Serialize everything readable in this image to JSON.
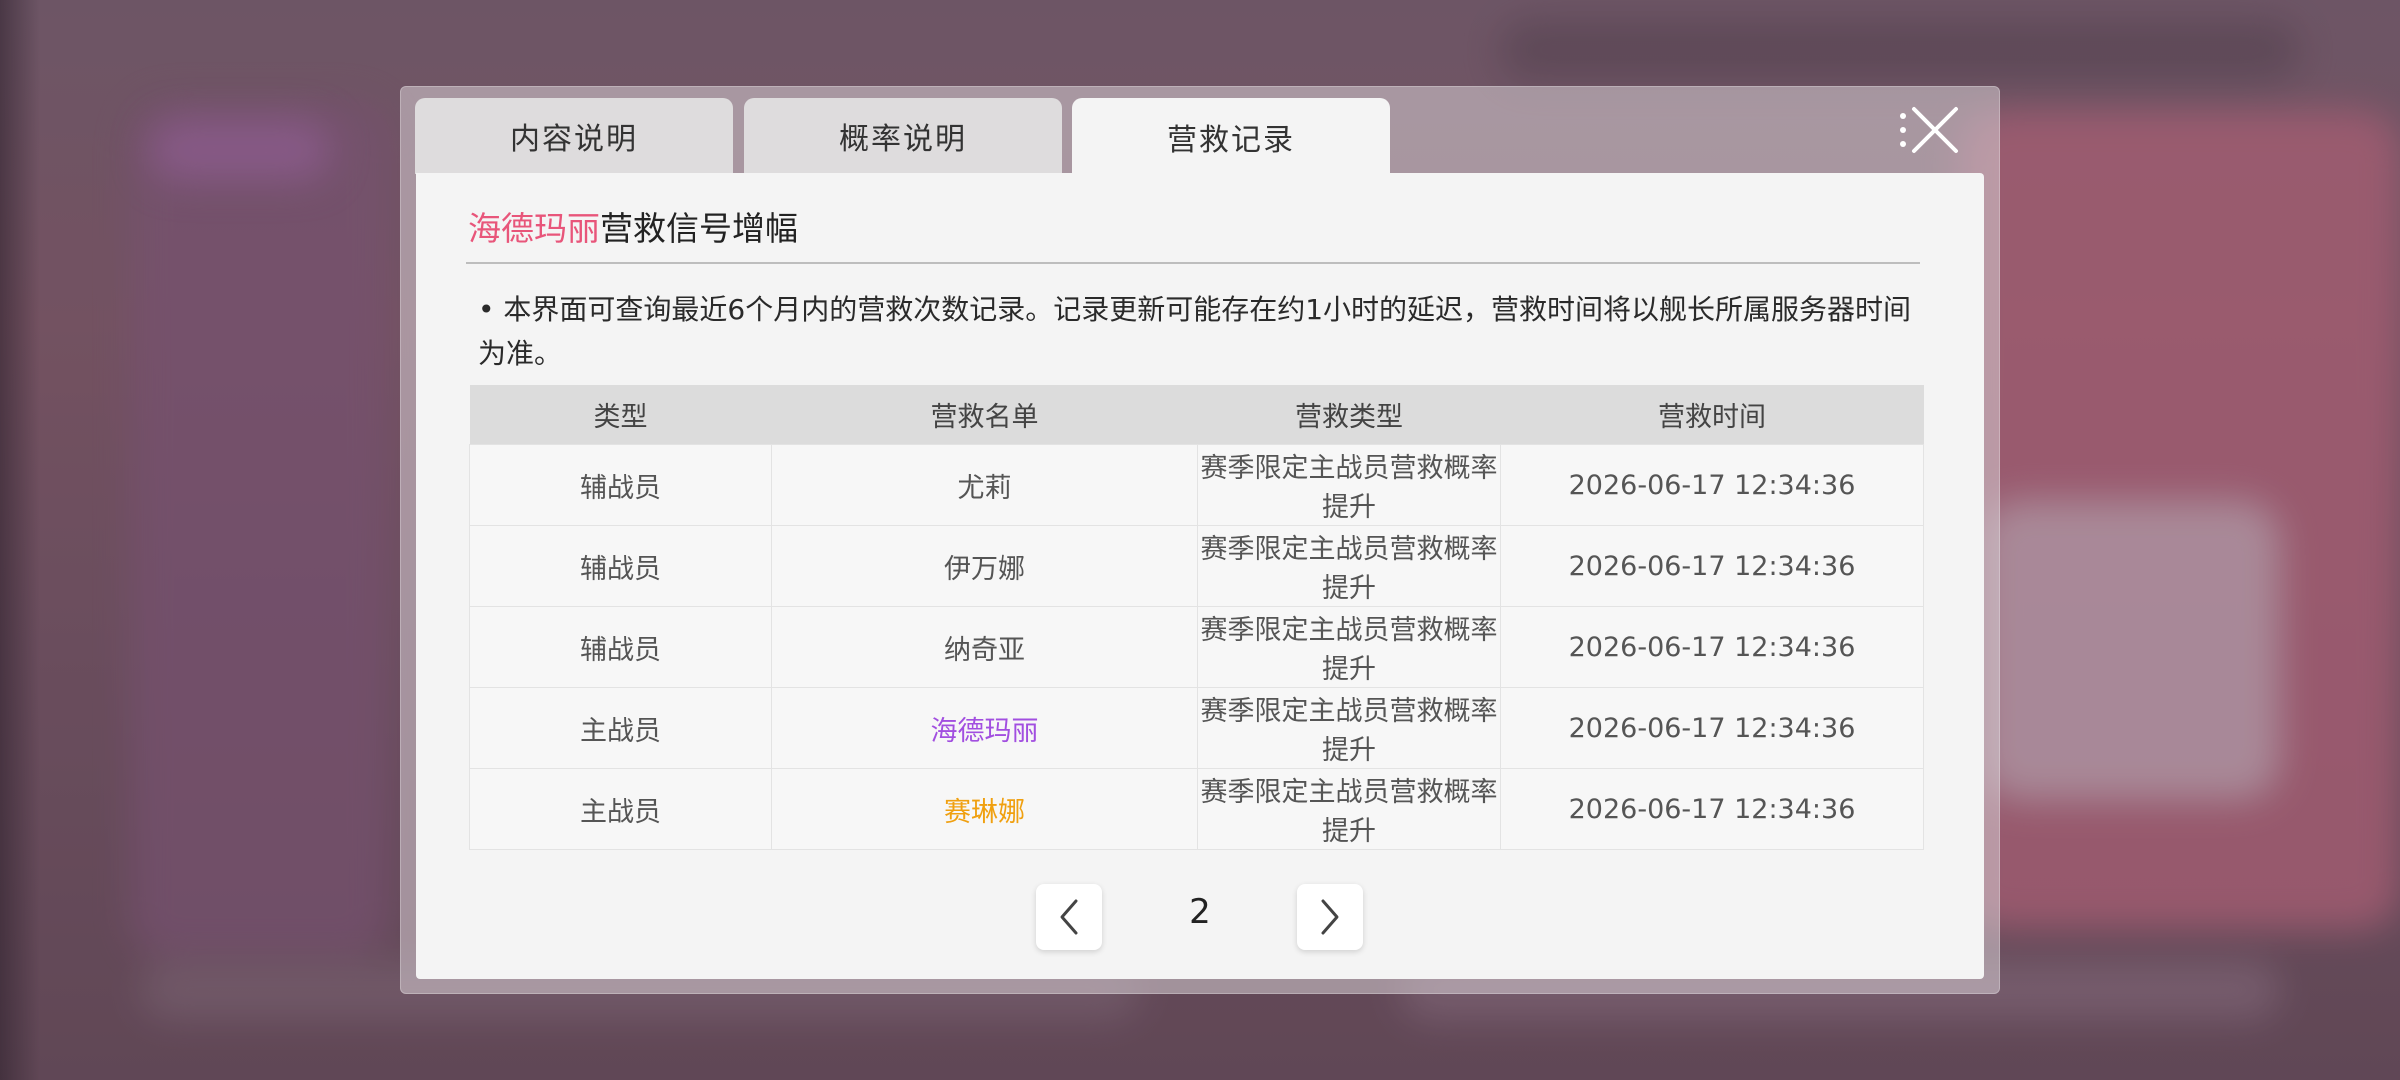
{
  "tabs": [
    {
      "label": "内容说明"
    },
    {
      "label": "概率说明"
    },
    {
      "label": "营救记录"
    }
  ],
  "title": {
    "highlight": "海德玛丽",
    "rest": "营救信号增幅"
  },
  "notice": "• 本界面可查询最近6个月内的营救次数记录。记录更新可能存在约1小时的延迟，营救时间将以舰长所属服务器时间为准。",
  "table": {
    "headers": [
      "类型",
      "营救名单",
      "营救类型",
      "营救时间"
    ],
    "rows": [
      {
        "kind": "辅战员",
        "name": "尤莉",
        "rescue_type": "赛季限定主战员营救概率提升",
        "time": "2026-06-17 12:34:36"
      },
      {
        "kind": "辅战员",
        "name": "伊万娜",
        "rescue_type": "赛季限定主战员营救概率提升",
        "time": "2026-06-17 12:34:36"
      },
      {
        "kind": "辅战员",
        "name": "纳奇亚",
        "rescue_type": "赛季限定主战员营救概率提升",
        "time": "2026-06-17 12:34:36"
      },
      {
        "kind": "主战员",
        "name": "海德玛丽",
        "rescue_type": "赛季限定主战员营救概率提升",
        "time": "2026-06-17 12:34:36"
      },
      {
        "kind": "主战员",
        "name": "赛琳娜",
        "rescue_type": "赛季限定主战员营救概率提升",
        "time": "2026-06-17 12:34:36"
      }
    ]
  },
  "pagination": {
    "page": "2"
  },
  "colors": {
    "title_highlight": "#e8557a",
    "name_purple": "#a24fe0",
    "name_gold": "#f0a010"
  },
  "icons": {
    "close": "close-icon",
    "prev": "chevron-left-icon",
    "next": "chevron-right-icon",
    "menu": "more-vertical-icon"
  }
}
